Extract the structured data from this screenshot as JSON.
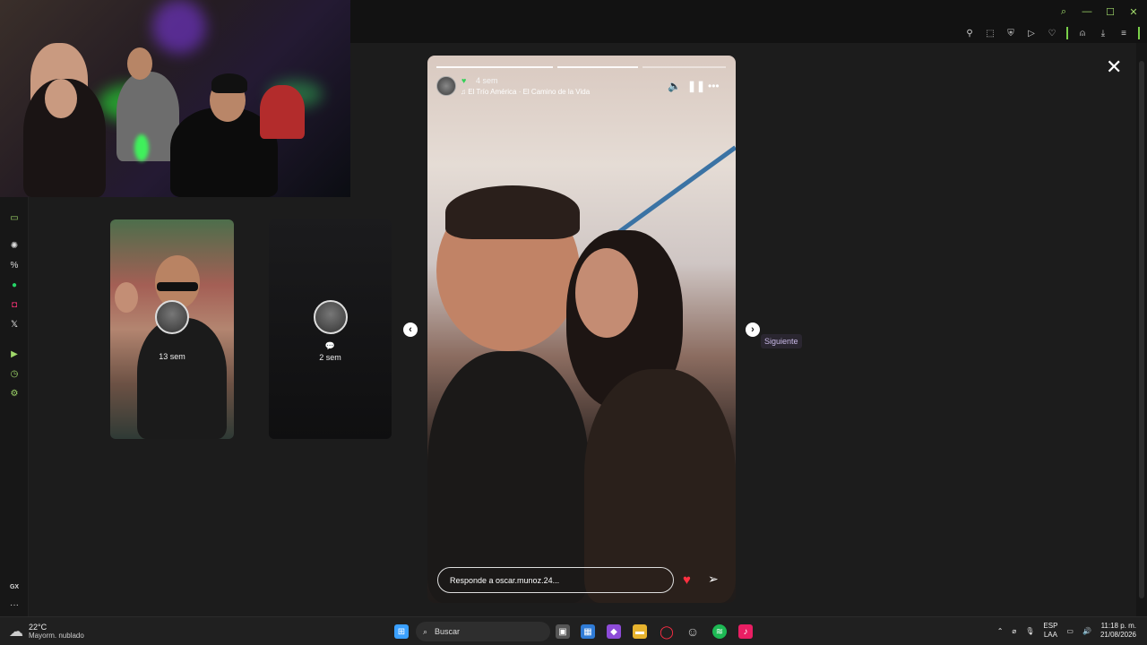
{
  "webcam": {},
  "sidebar": {
    "icons": [
      "game-controller-icon",
      "chatgpt-icon",
      "percent-icon",
      "whatsapp-icon",
      "instagram-icon",
      "x-icon",
      "play-icon",
      "clock-icon",
      "settings-icon",
      "gx-icon",
      "more-icon"
    ],
    "gx_label": "GX",
    "more_label": "···"
  },
  "thumbnails": [
    {
      "time": "13 sem"
    },
    {
      "time": "2 sem"
    }
  ],
  "story": {
    "time": "4 sem",
    "song": "El Trío América · El Camino de la Vida",
    "reply_placeholder": "Responde a oscar.munoz.24..."
  },
  "nav": {
    "prev": "‹",
    "next": "›",
    "tooltip": "Siguiente",
    "close": "✕"
  },
  "taskbar": {
    "temperature": "22°C",
    "weather_desc": "Mayorm. nublado",
    "search_placeholder": "Buscar",
    "lang_top": "ESP",
    "lang_bottom": "LAA",
    "time": "11:18 p. m.",
    "date": "21/08/2026"
  },
  "colors": {
    "accent": "#9fd86a",
    "heart": "#ff3040",
    "background": "#1c1c1c"
  }
}
